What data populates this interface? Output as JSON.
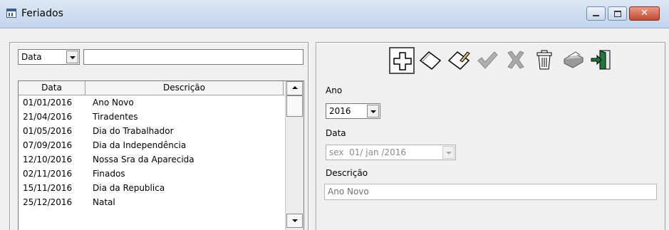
{
  "window": {
    "title": "Feriados"
  },
  "window_buttons": {
    "close": "✕"
  },
  "filter": {
    "field": "Data",
    "search_value": ""
  },
  "list": {
    "columns": [
      "Data",
      "Descrição"
    ],
    "rows": [
      {
        "date": "01/01/2016",
        "desc": "Ano Novo"
      },
      {
        "date": "21/04/2016",
        "desc": "Tiradentes"
      },
      {
        "date": "01/05/2016",
        "desc": "Dia do Trabalhador"
      },
      {
        "date": "07/09/2016",
        "desc": "Dia da Independência"
      },
      {
        "date": "12/10/2016",
        "desc": "Nossa Sra da Aparecida"
      },
      {
        "date": "02/11/2016",
        "desc": "Finados"
      },
      {
        "date": "15/11/2016",
        "desc": "Dia da Republica"
      },
      {
        "date": "25/12/2016",
        "desc": "Natal"
      }
    ]
  },
  "toolbar": {
    "icons": [
      "add-icon",
      "edit-icon",
      "edit-pencil-icon",
      "confirm-check-icon",
      "cancel-x-icon",
      "trash-icon",
      "print-icon",
      "exit-door-icon"
    ]
  },
  "form": {
    "ano_label": "Ano",
    "ano_value": "2016",
    "data_label": "Data",
    "data_value": "sex  01/ jan /2016",
    "descricao_label": "Descrição",
    "descricao_value": "Ano Novo"
  },
  "colors": {
    "check": "#b0b0b0",
    "cancel": "#a8a8a8",
    "exit": "#1e7a3c"
  }
}
